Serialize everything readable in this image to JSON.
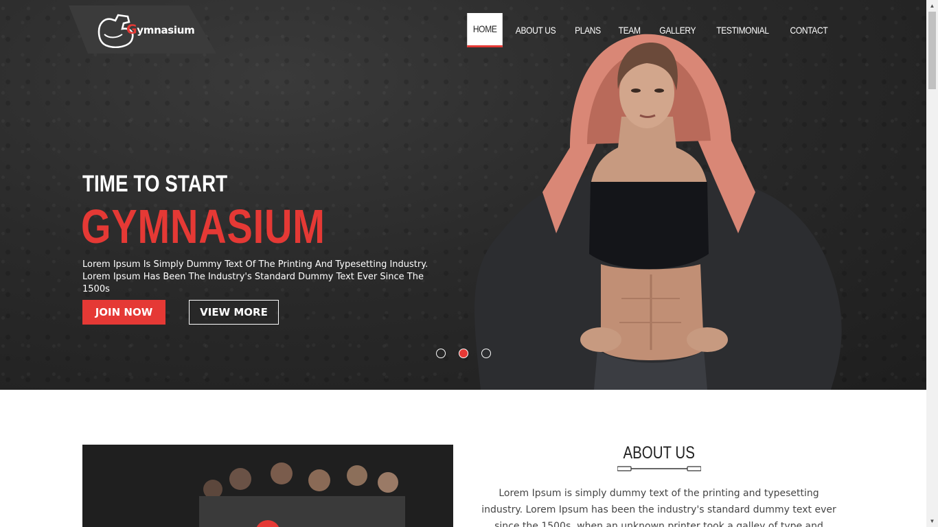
{
  "brand": {
    "logo_prefix": "G",
    "logo_text": "ymnasium"
  },
  "nav": {
    "items": [
      {
        "label": "HOME",
        "active": true
      },
      {
        "label": "ABOUT US"
      },
      {
        "label": "PLANS"
      },
      {
        "label": "TEAM"
      },
      {
        "label": "GALLERY"
      },
      {
        "label": "TESTIMONIAL"
      },
      {
        "label": "CONTACT"
      }
    ]
  },
  "hero": {
    "subtitle": "TIME TO START",
    "title": "GYMNASIUM",
    "description": "Lorem Ipsum Is Simply Dummy Text Of The Printing And Typesetting Industry. Lorem Ipsum Has Been The Industry's Standard Dummy Text Ever Since The 1500s",
    "join_label": "JOIN NOW",
    "view_label": "VIEW MORE",
    "slide_count": 3,
    "active_slide": 2
  },
  "about": {
    "title": "ABOUT US",
    "text": "Lorem Ipsum is simply dummy text of the printing and typesetting industry. Lorem Ipsum has been the industry's standard dummy text ever since the 1500s, when an unknown printer took a galley of type and scrambled it to make"
  },
  "colors": {
    "accent": "#e53935",
    "hero_bg": "#2a2a2a",
    "text_dark": "#222222"
  }
}
